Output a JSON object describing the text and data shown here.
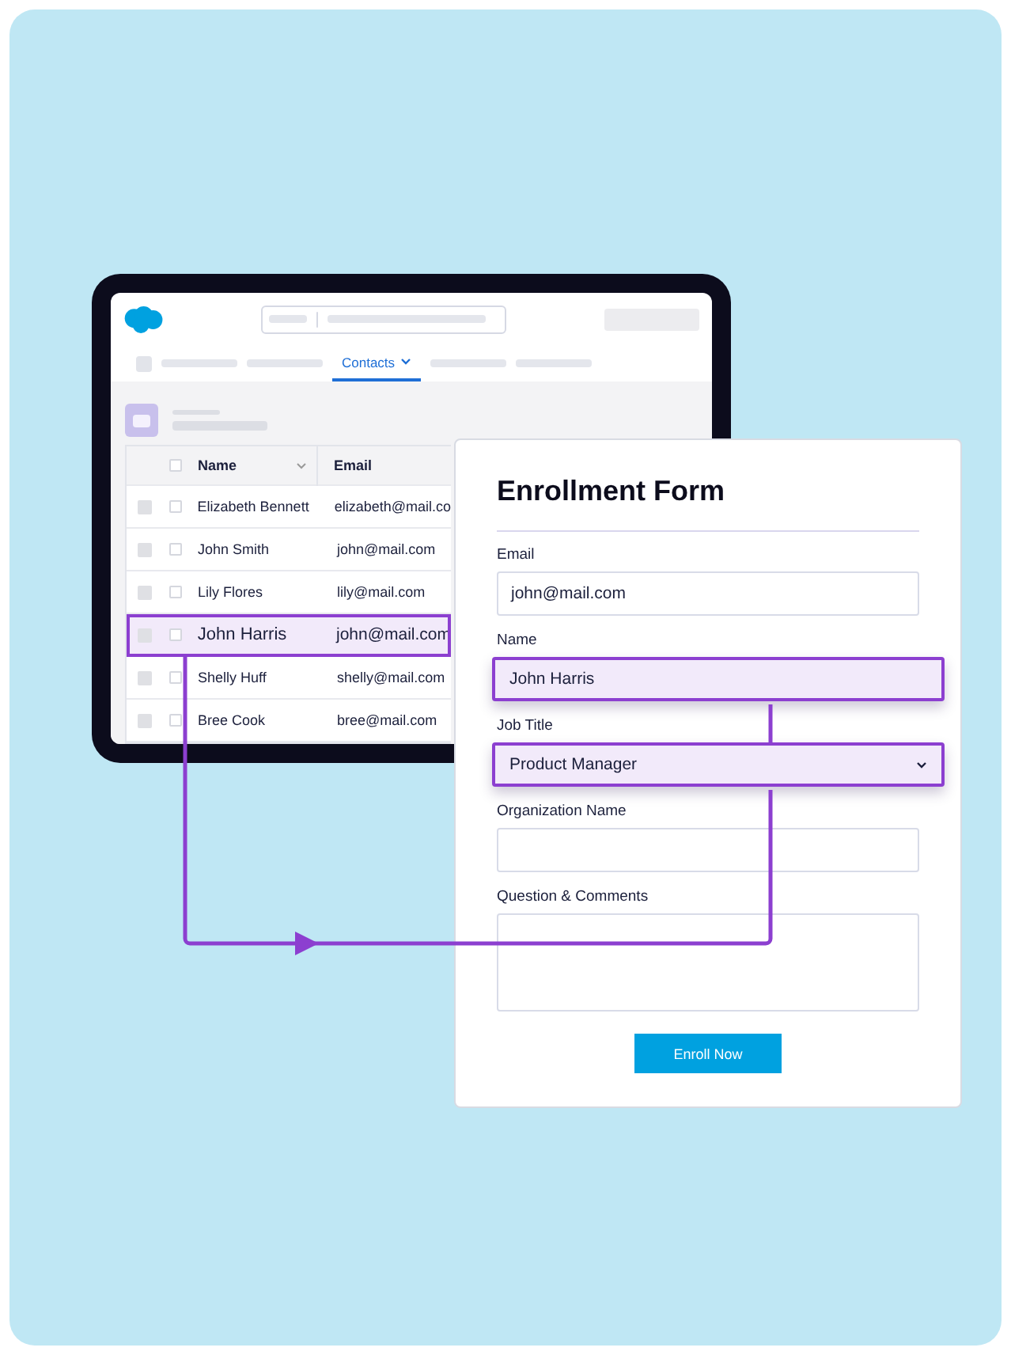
{
  "crm": {
    "nav_tabs": [
      {
        "label": "Contacts",
        "selected": true
      }
    ],
    "table": {
      "columns": [
        "Name",
        "Email"
      ],
      "all_checked": false,
      "rows": [
        {
          "name": "Elizabeth Bennett",
          "email": "elizabeth@mail.co",
          "selected": false,
          "checked": false
        },
        {
          "name": "John Smith",
          "email": "john@mail.com",
          "selected": false,
          "checked": false
        },
        {
          "name": "Lily Flores",
          "email": "lily@mail.com",
          "selected": false,
          "checked": false
        },
        {
          "name": "John Harris",
          "email": "john@mail.com",
          "selected": true,
          "checked": false
        },
        {
          "name": "Shelly Huff",
          "email": "shelly@mail.com",
          "selected": false,
          "checked": false
        },
        {
          "name": "Bree Cook",
          "email": "bree@mail.com",
          "selected": false,
          "checked": false
        }
      ]
    }
  },
  "form": {
    "title": "Enrollment Form",
    "fields": [
      {
        "kind": "text",
        "label": "Email",
        "value": "john@mail.com",
        "highlighted": false
      },
      {
        "kind": "text",
        "label": "Name",
        "value": "John Harris",
        "highlighted": true
      },
      {
        "kind": "select",
        "label": "Job Title",
        "value": "Product Manager",
        "highlighted": true
      },
      {
        "kind": "text",
        "label": "Organization Name",
        "highlighted": false
      },
      {
        "kind": "textarea",
        "label": "Question & Comments",
        "highlighted": false
      }
    ],
    "button": "Enroll Now"
  }
}
